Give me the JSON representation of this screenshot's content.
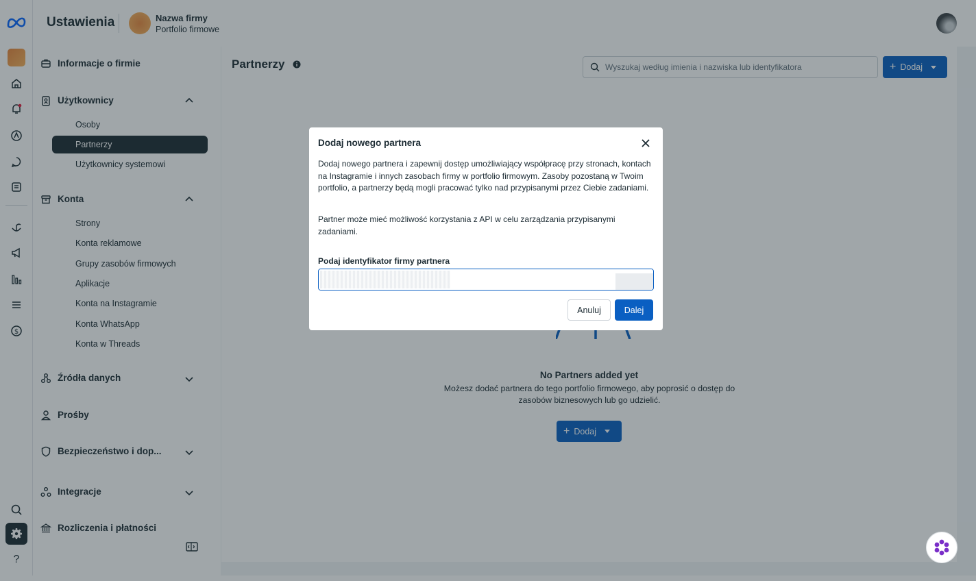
{
  "app": {
    "title": "Ustawienia",
    "business_name": "Nazwa firmy",
    "business_subtitle": "Portfolio firmowe"
  },
  "sidebar": {
    "company_info": "Informacje o firmie",
    "users": {
      "label": "Użytkownicy",
      "items": [
        "Osoby",
        "Partnerzy",
        "Użytkownicy systemowi"
      ]
    },
    "accounts": {
      "label": "Konta",
      "items": [
        "Strony",
        "Konta reklamowe",
        "Grupy zasobów firmowych",
        "Aplikacje",
        "Konta na Instagramie",
        "Konta WhatsApp",
        "Konta w Threads"
      ]
    },
    "data_sources": "Źródła danych",
    "requests": "Prośby",
    "security": "Bezpieczeństwo i dop...",
    "integrations": "Integracje",
    "billing": "Rozliczenia i płatności"
  },
  "main": {
    "page_title": "Partnerzy",
    "search_placeholder": "Wyszukaj według imienia i nazwiska lub identyfikatora",
    "add_label": "Dodaj",
    "empty_title": "No Partners added yet",
    "empty_desc": "Możesz dodać partnera do tego portfolio firmowego, aby poprosić o dostęp do zasobów biznesowych lub go udzielić.",
    "empty_add_label": "Dodaj"
  },
  "dialog": {
    "title": "Dodaj nowego partnera",
    "paragraph1": "Dodaj nowego partnera i zapewnij dostęp umożliwiający współpracę przy stronach, kontach na Instagramie i innych zasobach firmy w portfolio firmowym. Zasoby pozostaną w Twoim portfolio, a partnerzy będą mogli pracować tylko nad przypisanymi przez Ciebie zadaniami.",
    "paragraph2": "Partner może mieć możliwość korzystania z API w celu zarządzania przypisanymi zadaniami.",
    "field_label": "Podaj identyfikator firmy partnera",
    "field_value": "",
    "cancel_label": "Anuluj",
    "next_label": "Dalej"
  },
  "colors": {
    "primary": "#0a5fc2",
    "text": "#1c2b33",
    "overlay": "#1c2b33"
  }
}
